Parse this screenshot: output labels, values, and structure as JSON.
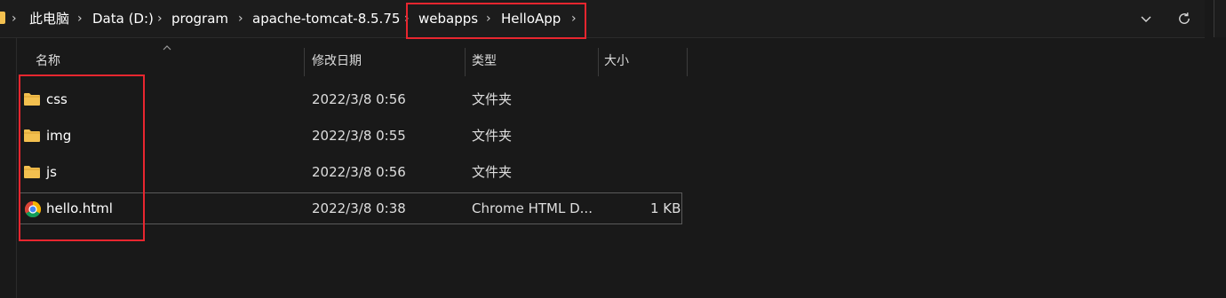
{
  "breadcrumb": {
    "items": [
      {
        "label": "此电脑"
      },
      {
        "label": "Data (D:)"
      },
      {
        "label": "program"
      },
      {
        "label": "apache-tomcat-8.5.75"
      },
      {
        "label": "webapps"
      },
      {
        "label": "HelloApp"
      }
    ],
    "separator": "›",
    "icons": [
      "folder-icon",
      "chevron-right-icon",
      "chevron-down-icon",
      "refresh-icon"
    ]
  },
  "columns": {
    "name": "名称",
    "modified": "修改日期",
    "type": "类型",
    "size": "大小",
    "sort_icon": "sort-up-icon"
  },
  "files": [
    {
      "name": "css",
      "modified": "2022/3/8 0:56",
      "type": "文件夹",
      "size": "",
      "icon": "folder-icon"
    },
    {
      "name": "img",
      "modified": "2022/3/8 0:55",
      "type": "文件夹",
      "size": "",
      "icon": "folder-icon"
    },
    {
      "name": "js",
      "modified": "2022/3/8 0:56",
      "type": "文件夹",
      "size": "",
      "icon": "folder-icon"
    },
    {
      "name": "hello.html",
      "modified": "2022/3/8 0:38",
      "type": "Chrome HTML D...",
      "size": "1 KB",
      "icon": "chrome-icon"
    }
  ],
  "colors": {
    "background": "#191919",
    "text": "#ffffff",
    "folder": "#f3c04f",
    "annotation_red": "#e8262f"
  }
}
